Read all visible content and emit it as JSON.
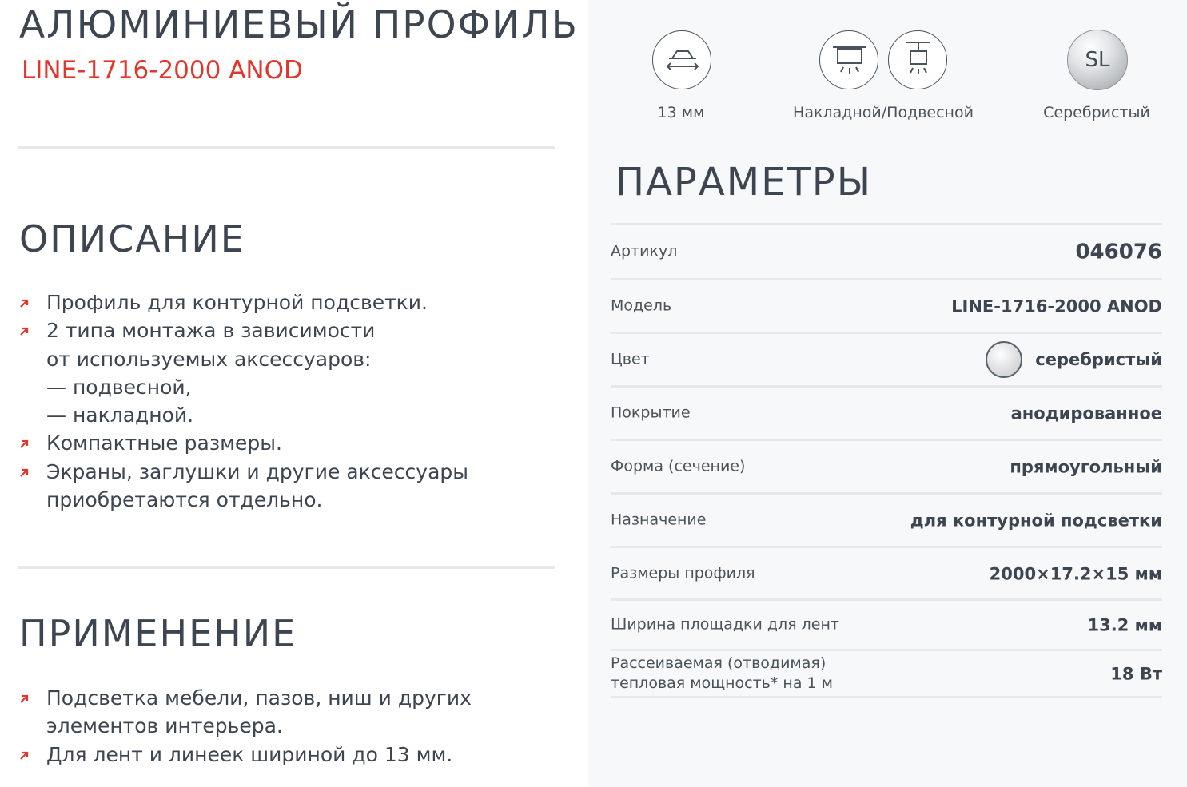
{
  "header": {
    "title": "АЛЮМИНИЕВЫЙ ПРОФИЛЬ",
    "subtitle": "LINE-1716-2000 ANOD"
  },
  "description": {
    "title": "ОПИСАНИЕ",
    "items": [
      [
        "Профиль для контурной подсветки."
      ],
      [
        "2 типа монтажа в зависимости",
        "от используемых аксессуаров:",
        "— подвесной,",
        "— накладной."
      ],
      [
        "Компактные размеры."
      ],
      [
        "Экраны, заглушки и другие аксессуары",
        "приобретаются отдельно."
      ]
    ]
  },
  "application": {
    "title": "ПРИМЕНЕНИЕ",
    "items": [
      [
        "Подсветка мебели, пазов, ниш и других",
        "элементов интерьера."
      ],
      [
        "Для лент и линеек шириной до 13 мм."
      ]
    ]
  },
  "features": [
    {
      "icon": "profile-width-icon",
      "label": "13 мм"
    },
    {
      "icon": "surface-mount-icon",
      "label": "Накладной/Подвесной"
    },
    {
      "icon": "suspended-mount-icon",
      "label": ""
    },
    {
      "icon": "silver-color-badge",
      "badge": "SL",
      "label": "Серебристый"
    }
  ],
  "parameters": {
    "title": "ПАРАМЕТРЫ",
    "rows": [
      {
        "label": [
          "Артикул"
        ],
        "value": "046076"
      },
      {
        "label": [
          "Модель"
        ],
        "value": "LINE-1716-2000 ANOD"
      },
      {
        "label": [
          "Цвет"
        ],
        "value": "серебристый",
        "swatch": true
      },
      {
        "label": [
          "Покрытие"
        ],
        "value": "анодированное"
      },
      {
        "label": [
          "Форма (сечение)"
        ],
        "value": "прямоугольный"
      },
      {
        "label": [
          "Назначение"
        ],
        "value": "для контурной подсветки"
      },
      {
        "label": [
          "Размеры профиля"
        ],
        "value": "2000×17.2×15 мм"
      },
      {
        "label": [
          "Ширина площадки для лент"
        ],
        "value": "13.2 мм"
      },
      {
        "label": [
          "Рассеиваемая (отводимая)",
          "тепловая мощность* на 1 м"
        ],
        "value": "18 Вт"
      }
    ]
  },
  "colors": {
    "accent": "#e2352b",
    "text": "#3d4650",
    "panel": "#f7f8f9",
    "divider": "#e6e8ea"
  }
}
